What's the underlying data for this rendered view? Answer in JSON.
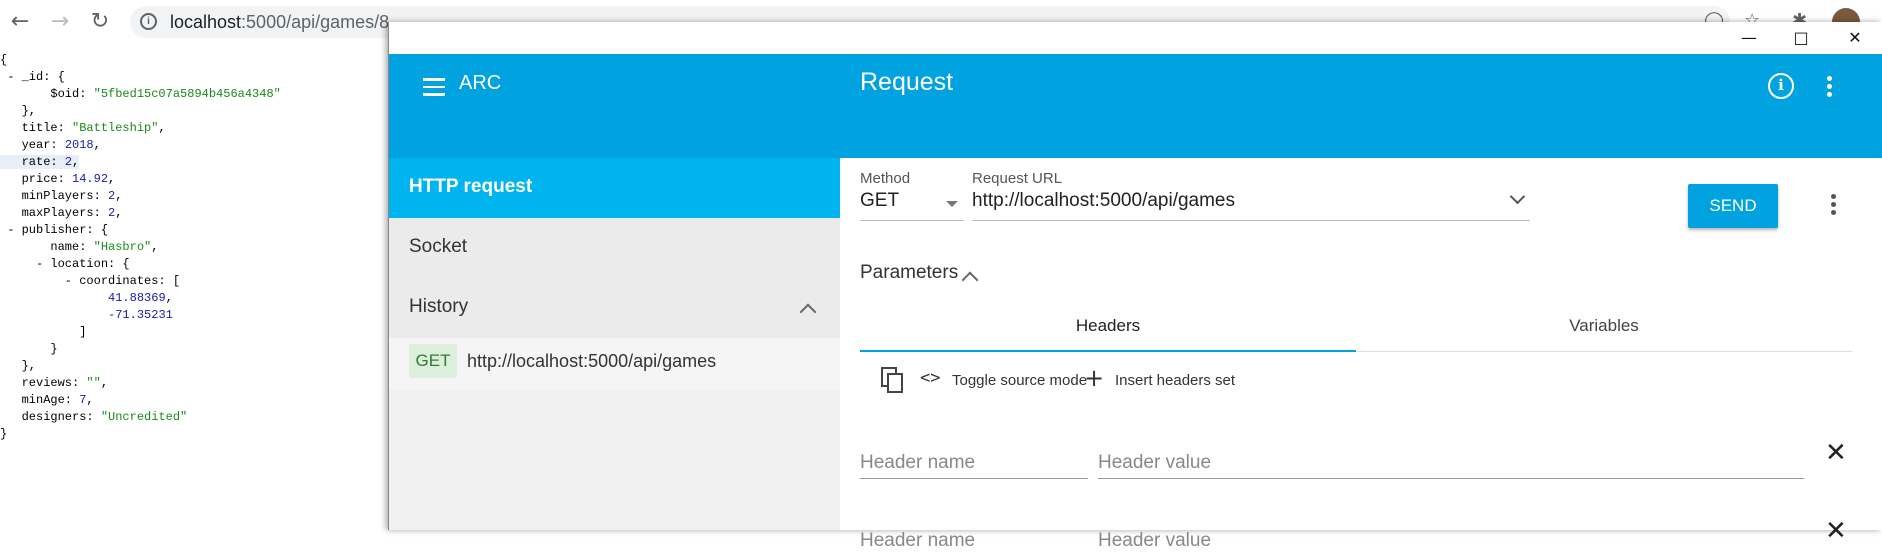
{
  "browser": {
    "url_host": "localhost",
    "url_path": ":5000/api/games/8"
  },
  "json_view": {
    "lines": [
      {
        "t": "{"
      },
      {
        "t": " - _id: {"
      },
      {
        "t": "       $oid: ",
        "s": "\"5fbed15c07a5894b456a4348\""
      },
      {
        "t": "   },"
      },
      {
        "t": "   title: ",
        "s": "\"Battleship\"",
        "e": ","
      },
      {
        "t": "   year: ",
        "n": "2018",
        "e": ","
      },
      {
        "t": "   rate: ",
        "n": "2",
        "e": ",",
        "hl": true
      },
      {
        "t": "   price: ",
        "n": "14.92",
        "e": ","
      },
      {
        "t": "   minPlayers: ",
        "n": "2",
        "e": ","
      },
      {
        "t": "   maxPlayers: ",
        "n": "2",
        "e": ","
      },
      {
        "t": " - publisher: {"
      },
      {
        "t": "       name: ",
        "s": "\"Hasbro\"",
        "e": ","
      },
      {
        "t": "     - location: {"
      },
      {
        "t": "         - coordinates: ["
      },
      {
        "t": "               ",
        "n": "41.88369",
        "e": ","
      },
      {
        "t": "               ",
        "n": "-71.35231"
      },
      {
        "t": "           ]"
      },
      {
        "t": "       }"
      },
      {
        "t": "   },"
      },
      {
        "t": "   reviews: ",
        "s": "\"\"",
        "e": ","
      },
      {
        "t": "   minAge: ",
        "n": "7",
        "e": ","
      },
      {
        "t": "   designers: ",
        "s": "\"Uncredited\""
      },
      {
        "t": "}"
      }
    ]
  },
  "arc": {
    "app_name": "ARC",
    "page_title": "Request",
    "nav": {
      "http_request": "HTTP request",
      "socket": "Socket",
      "history": "History",
      "history_item": {
        "method": "GET",
        "url": "http://localhost:5000/api/games"
      }
    },
    "request": {
      "method_label": "Method",
      "method_value": "GET",
      "url_label": "Request URL",
      "url_value": "http://localhost:5000/api/games",
      "send_label": "SEND"
    },
    "parameters": {
      "label": "Parameters",
      "tabs": [
        "Headers",
        "Variables"
      ],
      "tools": {
        "toggle_source": "Toggle source mode",
        "insert_set": "Insert headers set"
      },
      "header_name_placeholder": "Header name",
      "header_value_placeholder": "Header value"
    }
  },
  "colors": {
    "accent": "#00a3e0",
    "nav_active": "#00b4f0"
  }
}
